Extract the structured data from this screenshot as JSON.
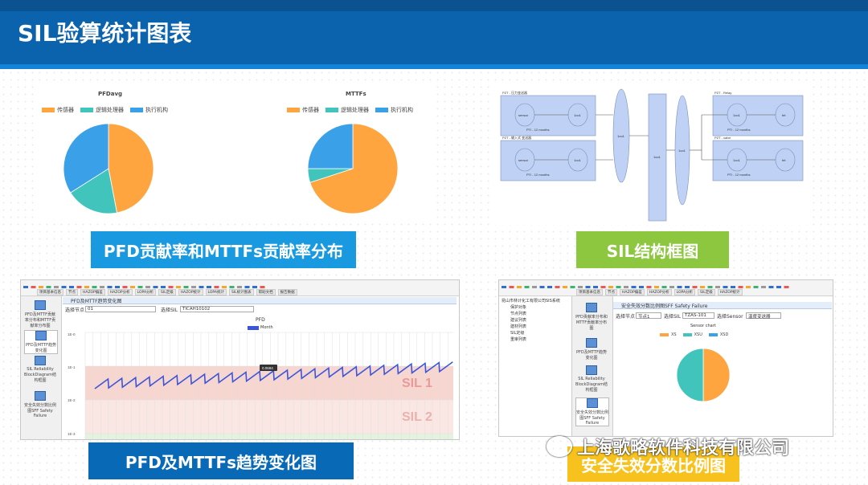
{
  "header": {
    "title": "SIL验算统计图表"
  },
  "colors": {
    "sensor": "#ffa540",
    "logic": "#40c4bb",
    "actuator": "#3aa0e8",
    "header": "#0a63ac"
  },
  "legend_items": [
    "传感器",
    "逻辑处理器",
    "执行机构"
  ],
  "charts": {
    "pfd": {
      "title": "PFDavg"
    },
    "mttf": {
      "title": "MTTFs"
    }
  },
  "chart_data": [
    {
      "type": "pie",
      "title": "PFDavg",
      "labels": [
        "传感器",
        "逻辑处理器",
        "执行机构"
      ],
      "values": [
        47,
        19,
        34
      ]
    },
    {
      "type": "pie",
      "title": "MTTFs",
      "labels": [
        "传感器",
        "逻辑处理器",
        "执行机构"
      ],
      "values": [
        70,
        5,
        25
      ]
    },
    {
      "type": "pie",
      "title": "Sensor chart",
      "labels": [
        "XS",
        "XSU",
        "XSD"
      ],
      "values": [
        50,
        50,
        0
      ]
    }
  ],
  "captions": {
    "pfd_mttf": "PFD贡献率和MTTFs贡献率分布",
    "sil_structure": "SIL结构框图",
    "trend": "PFD及MTTFs趋势变化图",
    "safe_fail": "安全失效分数比例图"
  },
  "structure": {
    "group_left_top": "PZT - 压力变送器",
    "group_left_bottom": "PZT - 输入式 变送器",
    "group_right_top": "PZT - Relay",
    "group_right_bottom": "PZT - valve",
    "pti": "PTI - 12 months",
    "vote_a": "1oo1",
    "vote_b": "1oo1",
    "node_sensor": "sensor",
    "node_logic": "1oo1",
    "node_final": "fet"
  },
  "trend": {
    "toolbar_tabs": [
      "项目基本信息",
      "节点",
      "HAZOP偏差",
      "HAZOP分析",
      "LOPA分析",
      "SIL定级",
      "HAZOP统计",
      "LOPA统计",
      "SIL统计图表",
      "帮助文档",
      "报告数据"
    ],
    "sidebar": [
      "PFD及MTTF贡献率分布和MTTF贡献率分布图",
      "PFD及MTTF趋势变化图",
      "SIL Reliability BlockDiagram结构框图",
      "安全失效分数比例图SFF Safety Failure"
    ],
    "panel_title": "PFD及MTTF趋势变化图",
    "node_label": "选择节点",
    "node_value": "01",
    "sil_label": "选择SIL",
    "sil_value": "TICAH10102",
    "chart_title": "PFD",
    "series_name": "Month",
    "y_ticks": [
      "1E-0",
      "1E-1",
      "1E-2",
      "1E-3"
    ],
    "tooltip": "0.0694",
    "band1": "SIL 1",
    "band2": "SIL 2"
  },
  "safe_fail": {
    "tree_root": "昆山市林计化工有限公司SIS系统",
    "tree_items": [
      "保护对象",
      "节点列表",
      "建议列表",
      "建材列表",
      "SIL定级",
      "重审列表"
    ],
    "sidebar": [
      "PFD贡献率分布和MTTF贡献率分布图",
      "PFD及MTTF趋势变化图",
      "SIL Reliability BlockDiagram结构框图",
      "安全失效分数比例图SFF Safety Failure"
    ],
    "panel_title": "安全失效分数比例图SFF Safety Failure",
    "node_label": "选择节点",
    "node_value": "节点1",
    "sil_label": "选择SIL",
    "sil_value": "TZAS-101",
    "sensor_label": "选择Sensor",
    "sensor_value": "温度变送器",
    "chart_title": "Sensor chart",
    "legend": [
      "XS",
      "XSU",
      "XSD"
    ]
  },
  "watermark": "上海歌略软件科技有限公司"
}
